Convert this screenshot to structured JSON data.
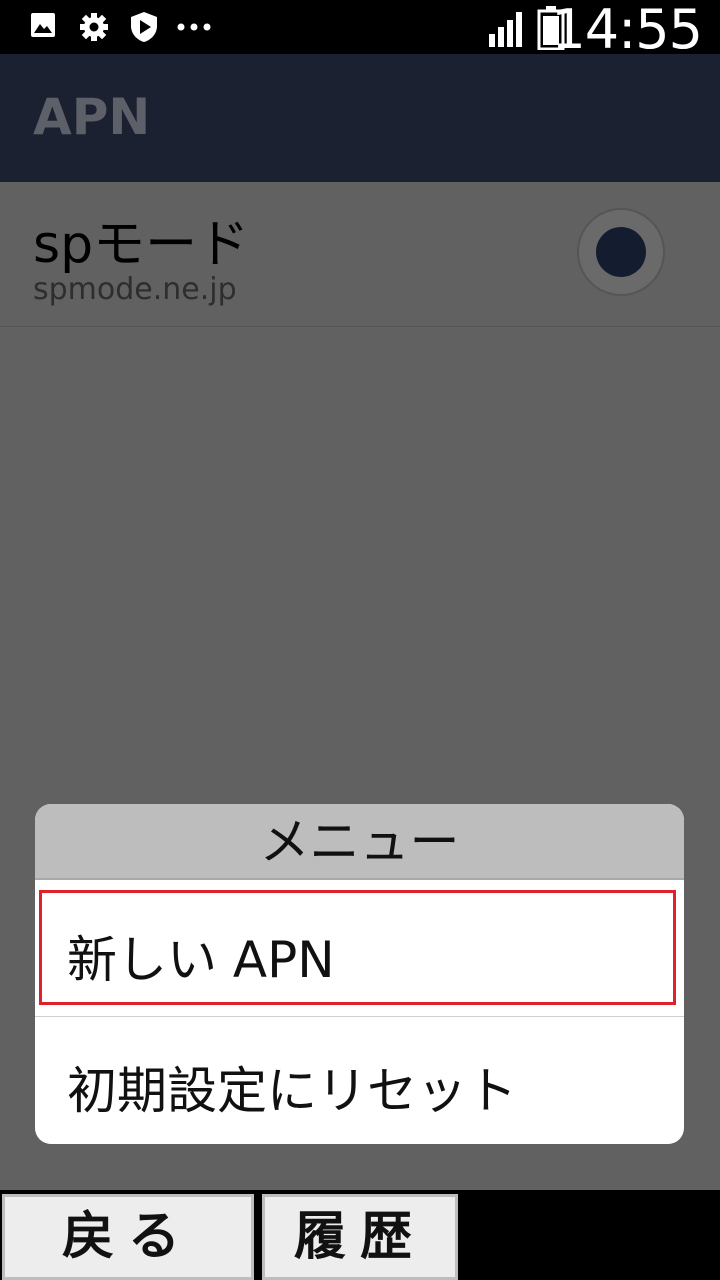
{
  "status_bar": {
    "time": "14:55",
    "icons": [
      "image-icon",
      "gear-icon",
      "shield-play-icon",
      "more-dots-icon",
      "signal-icon",
      "battery-icon"
    ]
  },
  "app_bar": {
    "title": "APN"
  },
  "apn_list": [
    {
      "name": "spモード",
      "apn": "spmode.ne.jp",
      "selected": true
    }
  ],
  "menu": {
    "title": "メニュー",
    "items": [
      {
        "label": "新しい APN",
        "highlighted": true
      },
      {
        "label": "初期設定にリセット",
        "highlighted": false
      }
    ]
  },
  "soft_keys": {
    "back": "戻る",
    "history": "履歴"
  },
  "colors": {
    "app_bar": "#1b2130",
    "highlight": "#e0202a",
    "scrim": "#616161"
  }
}
